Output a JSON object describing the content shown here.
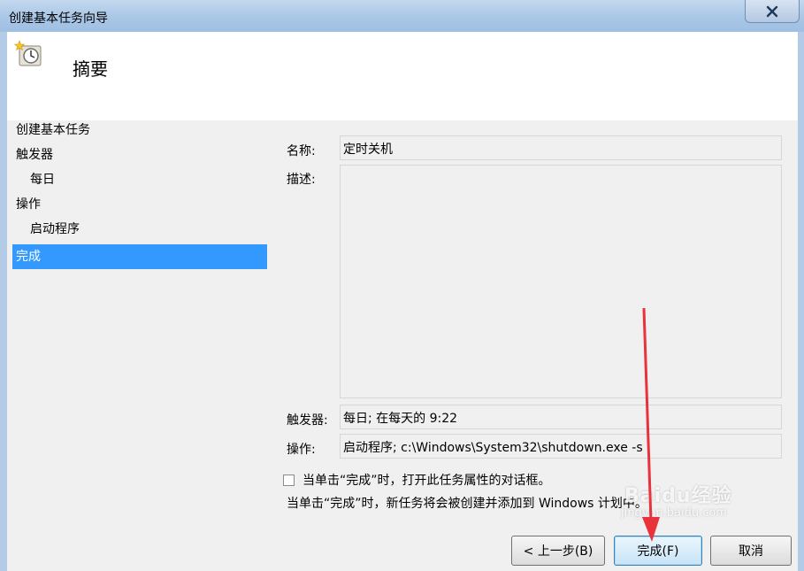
{
  "window": {
    "title": "创建基本任务向导"
  },
  "header": {
    "title": "摘要"
  },
  "sidebar": {
    "items": [
      {
        "label": "创建基本任务"
      },
      {
        "label": "触发器"
      },
      {
        "label": "每日"
      },
      {
        "label": "操作"
      },
      {
        "label": "启动程序"
      },
      {
        "label": "完成"
      }
    ]
  },
  "summary": {
    "name_label": "名称:",
    "name_value": "定时关机",
    "description_label": "描述:",
    "description_value": "",
    "trigger_label": "触发器:",
    "trigger_value": "每日; 在每天的 9:22",
    "action_label": "操作:",
    "action_value": "启动程序; c:\\Windows\\System32\\shutdown.exe -s"
  },
  "options": {
    "open_properties_label": "当单击“完成”时，打开此任务属性的对话框。",
    "open_properties_checked": false,
    "info_text": "当单击“完成”时，新任务将会被创建并添加到 Windows 计划中。"
  },
  "buttons": {
    "back_label": "< 上一步(B)",
    "finish_label": "完成(F)",
    "cancel_label": "取消"
  },
  "watermark": {
    "text": "Baidu经验",
    "sub": "jingyan.baidu.com"
  },
  "colors": {
    "selection": "#3399ff",
    "annotation_arrow": "#e8323c"
  }
}
